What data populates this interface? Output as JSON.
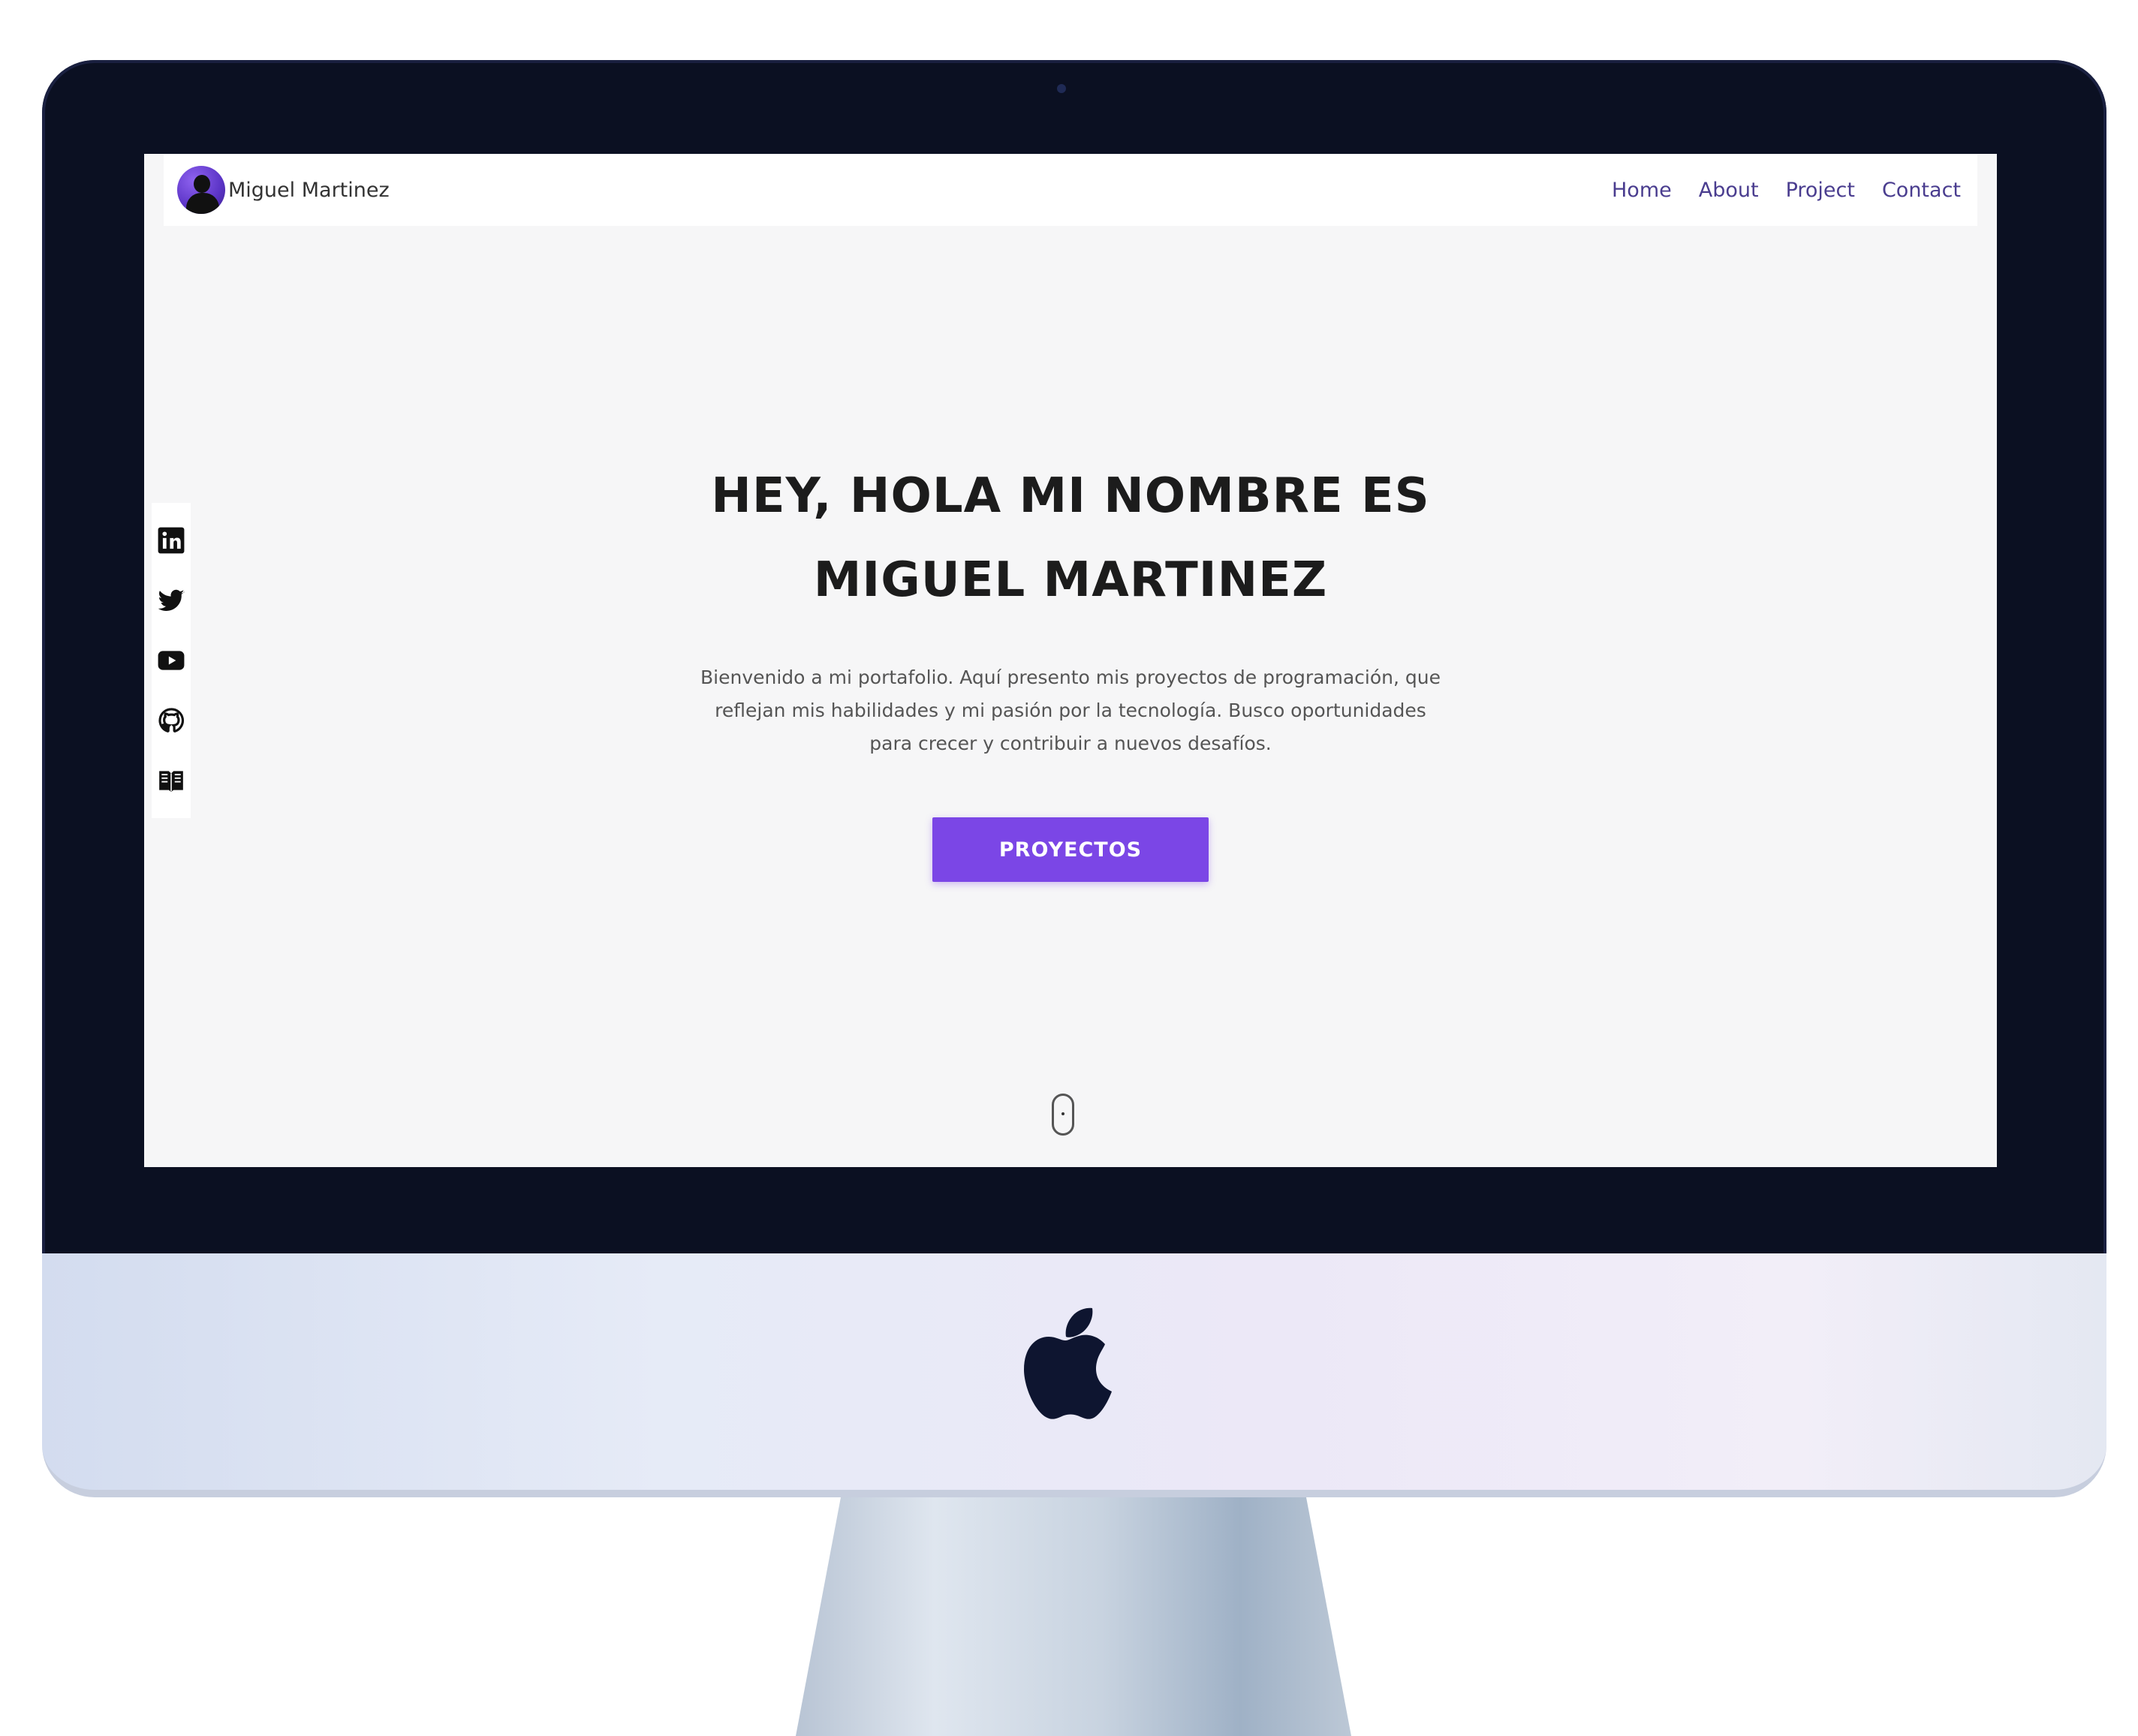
{
  "navbar": {
    "brand_name": "Miguel Martinez",
    "links": [
      {
        "label": "Home"
      },
      {
        "label": "About"
      },
      {
        "label": "Project"
      },
      {
        "label": "Contact"
      }
    ]
  },
  "social": {
    "items": [
      {
        "icon": "linkedin-icon"
      },
      {
        "icon": "twitter-icon"
      },
      {
        "icon": "youtube-icon"
      },
      {
        "icon": "github-icon"
      },
      {
        "icon": "book-icon"
      }
    ]
  },
  "hero": {
    "title_line1": "HEY, HOLA MI NOMBRE ES",
    "title_line2": "MIGUEL MARTINEZ",
    "description": "Bienvenido a mi portafolio. Aquí presento mis proyectos de programación, que reflejan mis habilidades y mi pasión por la tecnología. Busco oportunidades para crecer y contribuir a nuevos desafíos.",
    "cta_label": "PROYECTOS"
  },
  "colors": {
    "accent": "#7b46e6",
    "nav_link": "#4a3d8f",
    "bezel": "#0b1022",
    "page_bg": "#f6f6f7"
  }
}
